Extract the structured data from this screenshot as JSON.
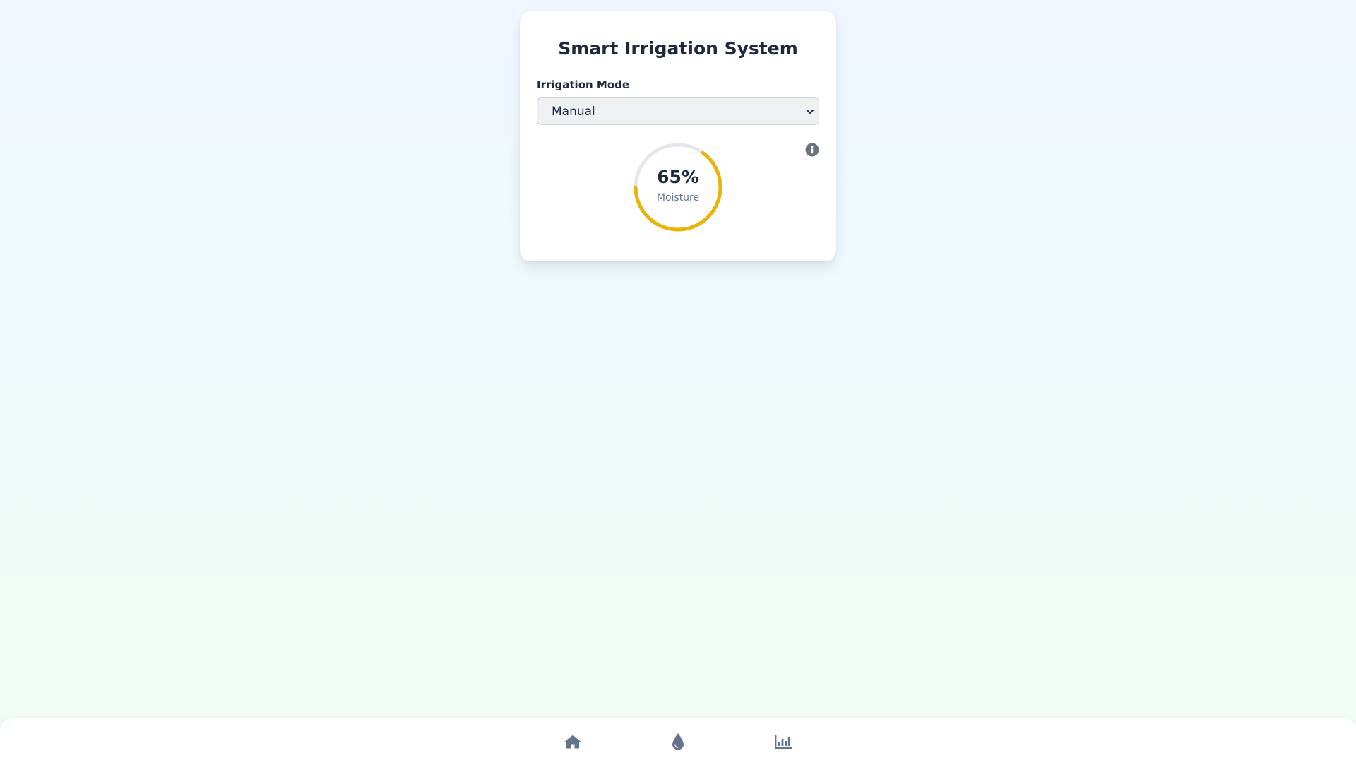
{
  "card": {
    "title": "Smart Irrigation System",
    "mode_label": "Irrigation Mode",
    "mode_selected": "Manual",
    "mode_options": [
      "Manual"
    ]
  },
  "gauge": {
    "value_text": "65%",
    "label": "Moisture",
    "fraction": 0.65,
    "color": "#eab308",
    "track_color": "#e5e7eb",
    "info_icon": "info-icon"
  },
  "bottom_nav": {
    "items": [
      {
        "icon": "home-icon"
      },
      {
        "icon": "water-drop-icon"
      },
      {
        "icon": "bar-chart-icon"
      }
    ],
    "icon_color": "#64748b"
  },
  "colors": {
    "background_top": "#eff6ff",
    "background_bottom": "#f0fdf4",
    "card": "#ffffff",
    "text_primary": "#1e293b",
    "text_secondary": "#64748b"
  }
}
